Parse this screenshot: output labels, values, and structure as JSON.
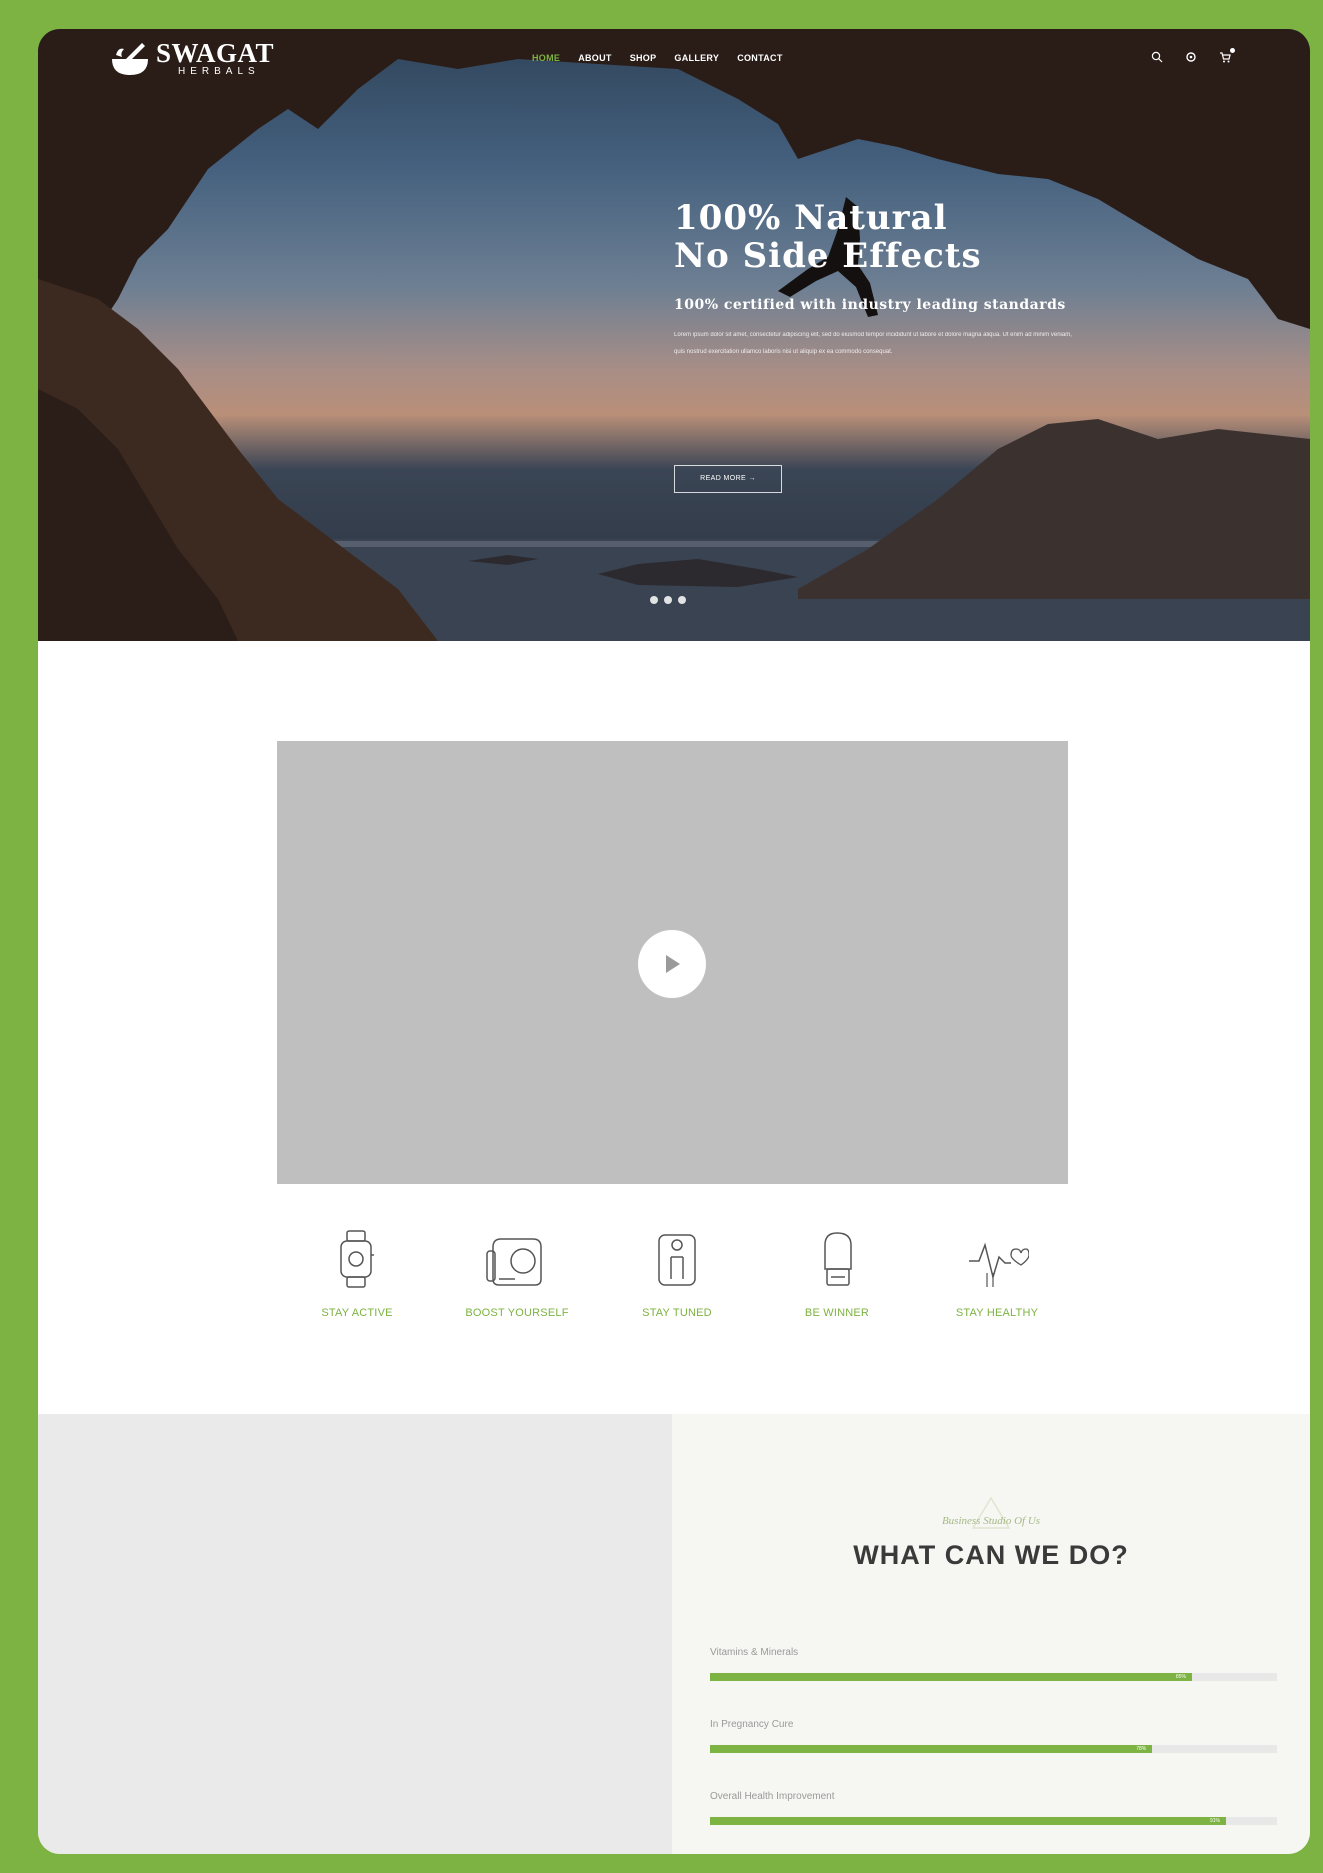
{
  "brand": {
    "name": "SWAGAT",
    "tagline": "HERBALS"
  },
  "nav": {
    "items": [
      {
        "label": "HOME",
        "active": true
      },
      {
        "label": "ABOUT",
        "active": false
      },
      {
        "label": "SHOP",
        "active": false
      },
      {
        "label": "GALLERY",
        "active": false
      },
      {
        "label": "CONTACT",
        "active": false
      }
    ],
    "icons": [
      "search-icon",
      "gear-icon",
      "cart-icon"
    ]
  },
  "hero": {
    "title_line1": "100% Natural",
    "title_line2": "No Side Effects",
    "subtitle": "100% certified with industry leading standards",
    "body": "Lorem ipsum dolor sit amet, consectetur adipiscing elit, sed do eiusmod tempor incididunt ut labore et dolore magna aliqua. Ut enim ad minim veniam, quis nostrud exercitation ullamco laboris nisi ut aliquip ex ea commodo consequat.",
    "button_label": "READ MORE →",
    "slides": 3
  },
  "video": {
    "play_icon": "play-icon"
  },
  "features": [
    {
      "icon": "smartwatch-icon",
      "label": "STAY ACTIVE"
    },
    {
      "icon": "scale-icon",
      "label": "BOOST YOURSELF"
    },
    {
      "icon": "body-scale-icon",
      "label": "STAY TUNED"
    },
    {
      "icon": "boxing-glove-icon",
      "label": "BE WINNER"
    },
    {
      "icon": "heartbeat-icon",
      "label": "STAY HEALTHY"
    }
  ],
  "about": {
    "kicker": "Business Studio Of Us",
    "title": "WHAT CAN WE DO?",
    "skills": [
      {
        "label": "Vitamins & Minerals",
        "percent": 85,
        "percent_label": "85%"
      },
      {
        "label": "In Pregnancy Cure",
        "percent": 78,
        "percent_label": "78%"
      },
      {
        "label": "Overall Health Improvement",
        "percent": 91,
        "percent_label": "91%"
      }
    ]
  },
  "colors": {
    "accent": "#7cb342",
    "frame": "#7cb342",
    "video_bg": "#bfbfbf",
    "heading": "#3a3a3a"
  }
}
